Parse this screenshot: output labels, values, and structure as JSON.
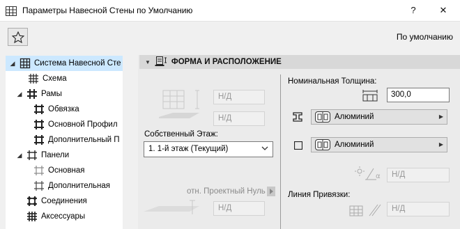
{
  "window": {
    "title": "Параметры Навесной Стены по Умолчанию",
    "help_label": "?",
    "close_label": "✕"
  },
  "toolbar": {
    "default_label": "По умолчанию"
  },
  "tree": {
    "items": [
      {
        "label": "Система Навесной Сте",
        "expanded": true,
        "selected": true
      },
      {
        "label": "Схема"
      },
      {
        "label": "Рамы",
        "expanded": true
      },
      {
        "label": "Обвязка"
      },
      {
        "label": "Основной Профил"
      },
      {
        "label": "Дополнительный П"
      },
      {
        "label": "Панели",
        "expanded": true
      },
      {
        "label": "Основная"
      },
      {
        "label": "Дополнительная"
      },
      {
        "label": "Соединения"
      },
      {
        "label": "Аксессуары"
      }
    ]
  },
  "section": {
    "title": "ФОРМА И РАСПОЛОЖЕНИЕ"
  },
  "left": {
    "na_1": "Н/Д",
    "na_2": "Н/Д",
    "story_label": "Собственный Этаж:",
    "story_value": "1. 1-й этаж (Текущий)",
    "ref_label": "отн. Проектный Нуль",
    "na_3": "Н/Д"
  },
  "right": {
    "thickness_label": "Номинальная Толщина:",
    "thickness_value": "300,0",
    "material_1": "Алюминий",
    "material_2": "Алюминий",
    "na_angle": "Н/Д",
    "ref_line_label": "Линия Привязки:",
    "na_ref": "Н/Д"
  }
}
